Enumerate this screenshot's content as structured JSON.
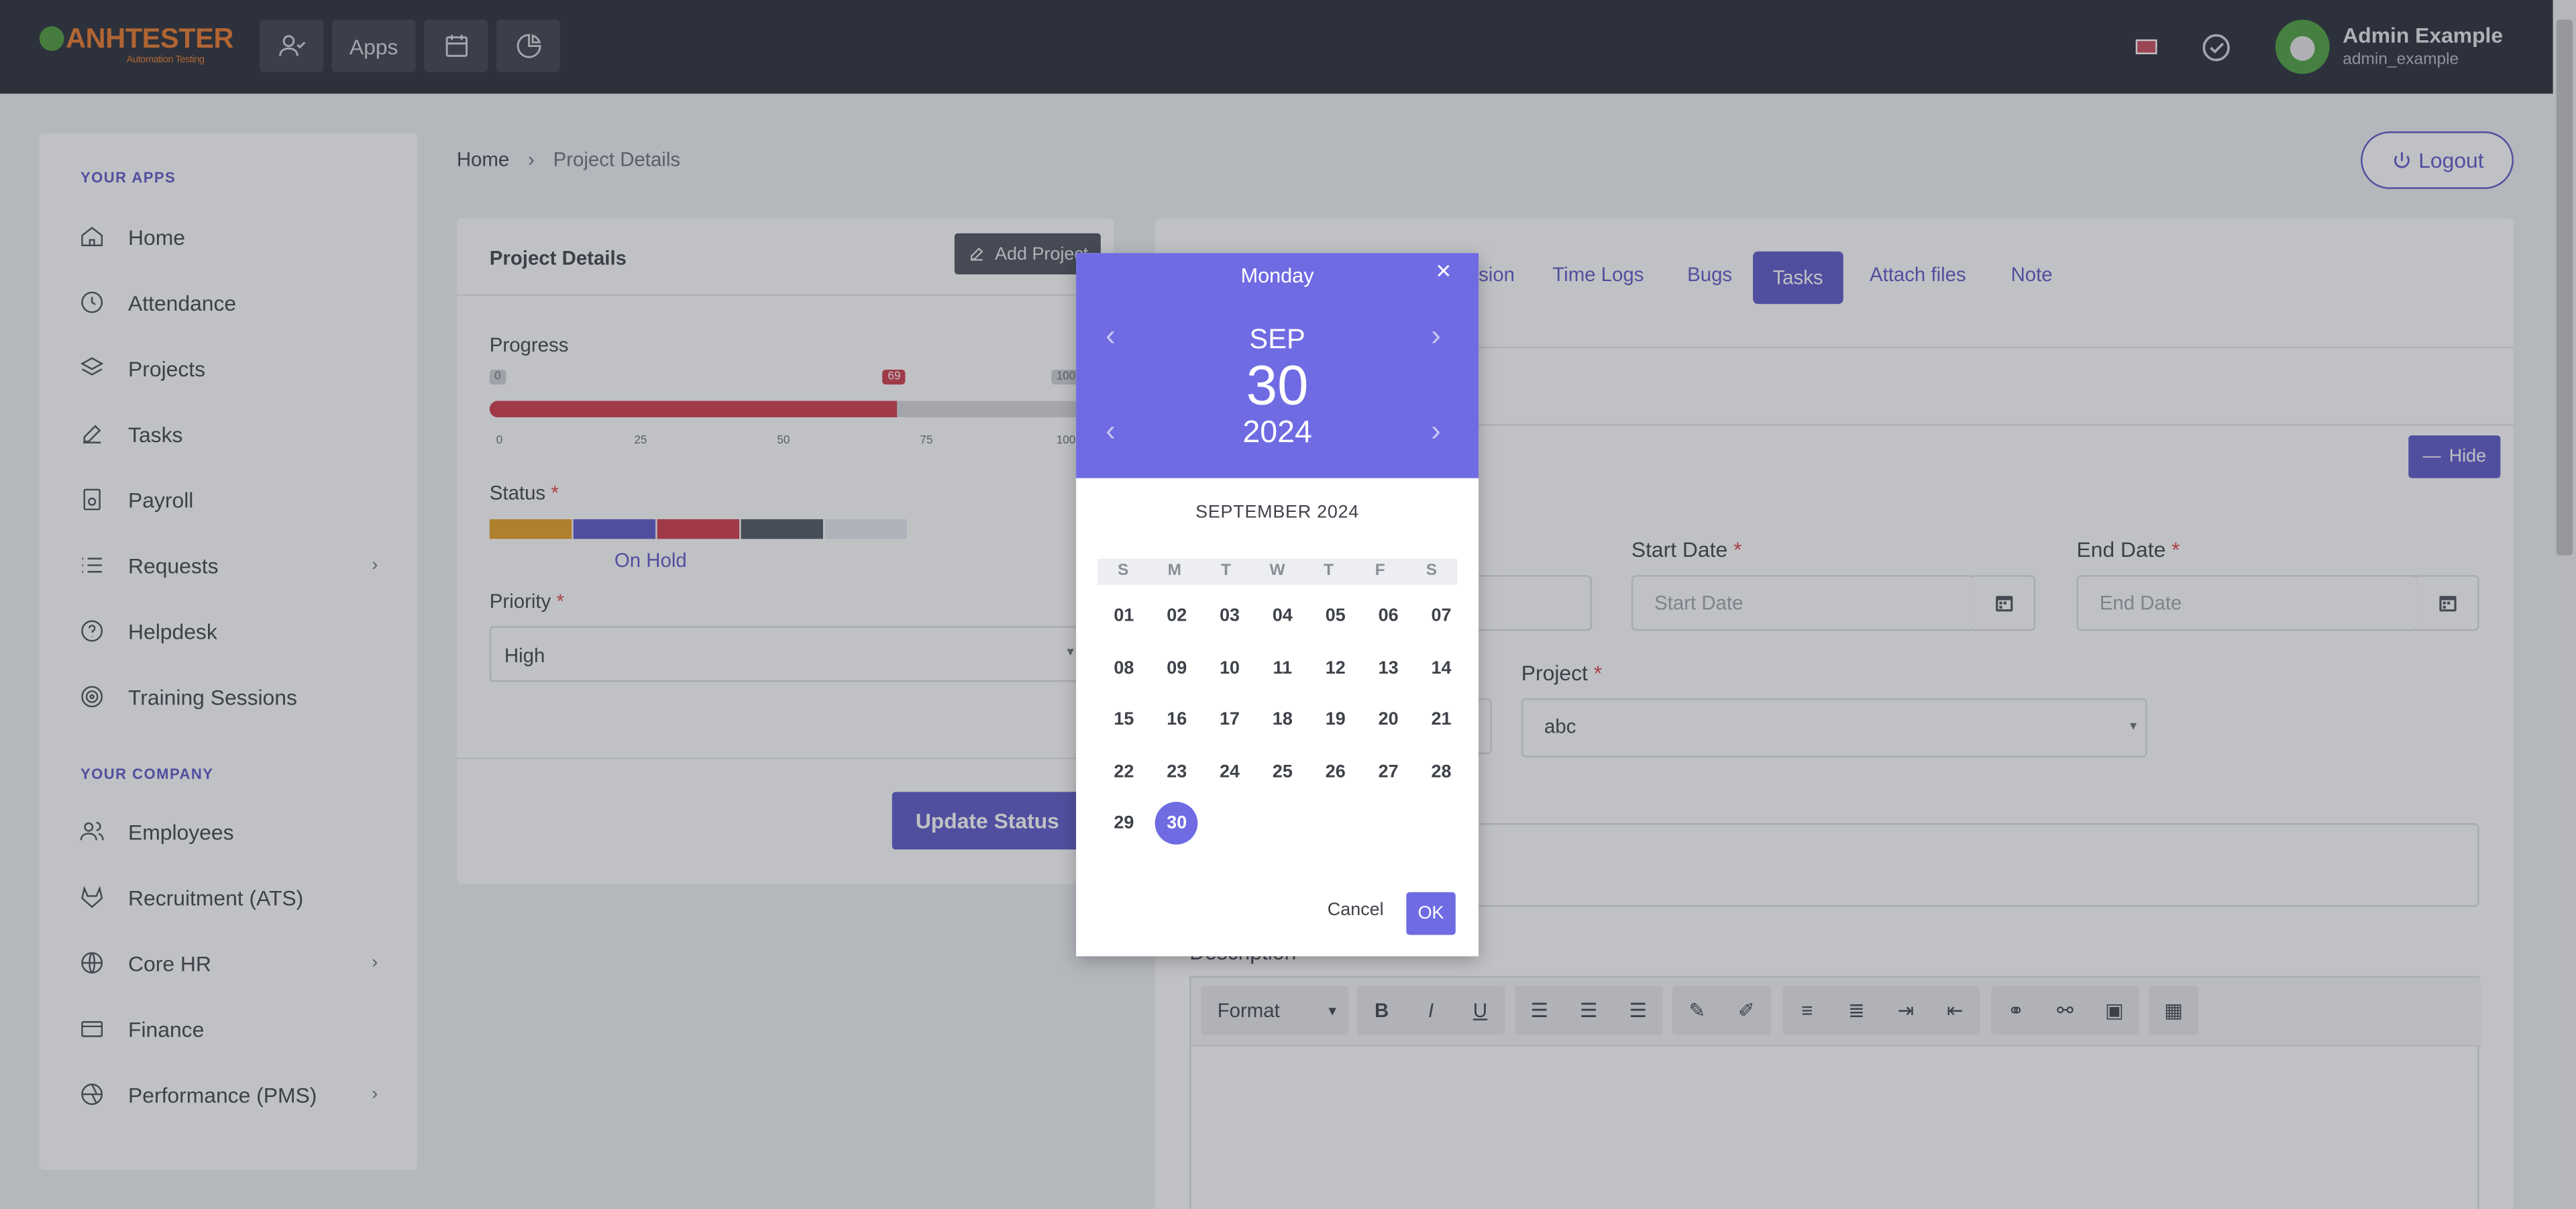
{
  "header": {
    "logo_text": "ANHTESTER",
    "logo_subtitle": "Automation Testing",
    "apps_label": "Apps",
    "user_name": "Admin Example",
    "user_handle": "admin_example"
  },
  "sidebar": {
    "apps_heading": "YOUR APPS",
    "apps_items": [
      {
        "label": "Home"
      },
      {
        "label": "Attendance"
      },
      {
        "label": "Projects"
      },
      {
        "label": "Tasks"
      },
      {
        "label": "Payroll"
      },
      {
        "label": "Requests"
      },
      {
        "label": "Helpdesk"
      },
      {
        "label": "Training Sessions"
      }
    ],
    "company_heading": "YOUR COMPANY",
    "company_items": [
      {
        "label": "Employees"
      },
      {
        "label": "Recruitment (ATS)"
      },
      {
        "label": "Core HR"
      },
      {
        "label": "Finance"
      },
      {
        "label": "Performance (PMS)"
      }
    ]
  },
  "breadcrumb": {
    "home": "Home",
    "current": "Project Details"
  },
  "logout_label": "Logout",
  "project_card": {
    "title": "Project Details",
    "add_project_label": "Add Project",
    "progress_label": "Progress",
    "progress_value": 69,
    "progress_min": "0",
    "progress_max": "100",
    "progress_ticks": [
      "0",
      "25",
      "50",
      "75",
      "100"
    ],
    "status_label": "Status",
    "status_value": "On Hold",
    "status_colors": [
      "#e6a021",
      "#5a57c9",
      "#d0394a",
      "#4f5661",
      "#e8e9f2"
    ],
    "priority_label": "Priority",
    "priority_value": "High",
    "update_button": "Update Status"
  },
  "tabs": [
    {
      "label": "sion"
    },
    {
      "label": "Time Logs"
    },
    {
      "label": "Bugs"
    },
    {
      "label": "Tasks",
      "active": true
    },
    {
      "label": "Attach files"
    },
    {
      "label": "Note"
    }
  ],
  "task_form": {
    "hide_label": "Hide",
    "start_date_label": "Start Date",
    "start_date_placeholder": "Start Date",
    "end_date_label": "End Date",
    "end_date_placeholder": "End Date",
    "project_label": "Project",
    "project_value": "abc",
    "description_label": "Description",
    "format_label": "Format",
    "toolbar_bold": "B",
    "toolbar_italic": "I",
    "toolbar_underline": "U"
  },
  "datepicker": {
    "weekday": "Monday",
    "month_short": "SEP",
    "day": "30",
    "year": "2024",
    "month_title": "SEPTEMBER 2024",
    "dow": [
      "S",
      "M",
      "T",
      "W",
      "T",
      "F",
      "S"
    ],
    "weeks": [
      [
        "01",
        "02",
        "03",
        "04",
        "05",
        "06",
        "07"
      ],
      [
        "08",
        "09",
        "10",
        "11",
        "12",
        "13",
        "14"
      ],
      [
        "15",
        "16",
        "17",
        "18",
        "19",
        "20",
        "21"
      ],
      [
        "22",
        "23",
        "24",
        "25",
        "26",
        "27",
        "28"
      ],
      [
        "29",
        "30"
      ]
    ],
    "selected": "30",
    "cancel_label": "Cancel",
    "ok_label": "OK",
    "close_symbol": "×"
  }
}
